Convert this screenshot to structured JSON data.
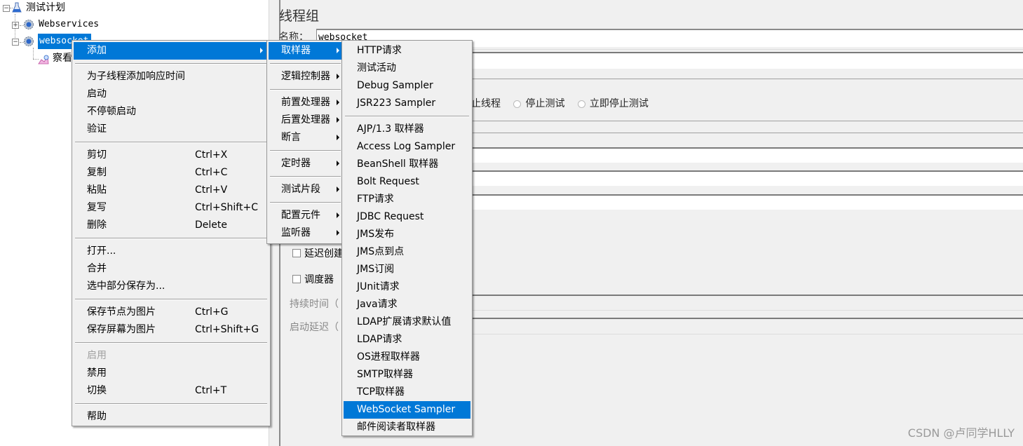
{
  "tree": {
    "root": {
      "label": "测试计划",
      "icon": "flask-icon"
    },
    "items": [
      {
        "label": "Webservices",
        "icon": "gear-icon",
        "expanded": false
      },
      {
        "label": "websocket",
        "icon": "gear-icon",
        "expanded": true,
        "selected": true
      },
      {
        "label": "察看结果树",
        "visible_label": "察看",
        "icon": "graph-icon"
      }
    ]
  },
  "panel": {
    "title": "线程组",
    "name_label": "名称：",
    "name_value": "websocket",
    "radio_options": [
      "停止线程",
      "停止测试",
      "立即停止测试"
    ],
    "radio_visible_partial": "止线程",
    "delay_thread_creation": "延迟创建",
    "scheduler": "调度器",
    "duration_label": "持续时间（",
    "startup_delay_label": "启动延迟（"
  },
  "context_menu": {
    "items": [
      {
        "label": "添加",
        "submenu": true,
        "highlighted": true
      },
      {
        "separator": true
      },
      {
        "label": "为子线程添加响应时间"
      },
      {
        "label": "启动"
      },
      {
        "label": "不停顿启动"
      },
      {
        "label": "验证"
      },
      {
        "separator": true
      },
      {
        "label": "剪切",
        "shortcut": "Ctrl+X"
      },
      {
        "label": "复制",
        "shortcut": "Ctrl+C"
      },
      {
        "label": "粘贴",
        "shortcut": "Ctrl+V"
      },
      {
        "label": "复写",
        "shortcut": "Ctrl+Shift+C"
      },
      {
        "label": "删除",
        "shortcut": "Delete"
      },
      {
        "separator": true
      },
      {
        "label": "打开..."
      },
      {
        "label": "合并"
      },
      {
        "label": "选中部分保存为..."
      },
      {
        "separator": true
      },
      {
        "label": "保存节点为图片",
        "shortcut": "Ctrl+G"
      },
      {
        "label": "保存屏幕为图片",
        "shortcut": "Ctrl+Shift+G"
      },
      {
        "separator": true
      },
      {
        "label": "启用",
        "disabled": true
      },
      {
        "label": "禁用"
      },
      {
        "label": "切换",
        "shortcut": "Ctrl+T"
      },
      {
        "separator": true
      },
      {
        "label": "帮助"
      }
    ]
  },
  "add_submenu": {
    "items": [
      {
        "label": "取样器",
        "highlighted": true
      },
      {
        "separator": true
      },
      {
        "label": "逻辑控制器"
      },
      {
        "separator": true
      },
      {
        "label": "前置处理器"
      },
      {
        "label": "后置处理器"
      },
      {
        "label": "断言"
      },
      {
        "separator": true
      },
      {
        "label": "定时器"
      },
      {
        "separator": true
      },
      {
        "label": "测试片段"
      },
      {
        "separator": true
      },
      {
        "label": "配置元件"
      },
      {
        "label": "监听器"
      }
    ]
  },
  "sampler_submenu": {
    "items": [
      {
        "label": "HTTP请求"
      },
      {
        "label": "测试活动"
      },
      {
        "label": "Debug Sampler"
      },
      {
        "label": "JSR223 Sampler"
      },
      {
        "separator": true
      },
      {
        "label": "AJP/1.3 取样器"
      },
      {
        "label": "Access Log Sampler"
      },
      {
        "label": "BeanShell 取样器"
      },
      {
        "label": "Bolt Request"
      },
      {
        "label": "FTP请求"
      },
      {
        "label": "JDBC Request"
      },
      {
        "label": "JMS发布"
      },
      {
        "label": "JMS点到点"
      },
      {
        "label": "JMS订阅"
      },
      {
        "label": "JUnit请求"
      },
      {
        "label": "Java请求"
      },
      {
        "label": "LDAP扩展请求默认值"
      },
      {
        "label": "LDAP请求"
      },
      {
        "label": "OS进程取样器"
      },
      {
        "label": "SMTP取样器"
      },
      {
        "label": "TCP取样器"
      },
      {
        "label": "WebSocket Sampler",
        "highlighted": true
      },
      {
        "label": "邮件阅读者取样器"
      }
    ]
  },
  "watermark": "CSDN @卢同学HLLY",
  "colors": {
    "highlight": "#0078d7",
    "menu_bg": "#f0f0f0",
    "disabled": "#a0a0a0"
  }
}
